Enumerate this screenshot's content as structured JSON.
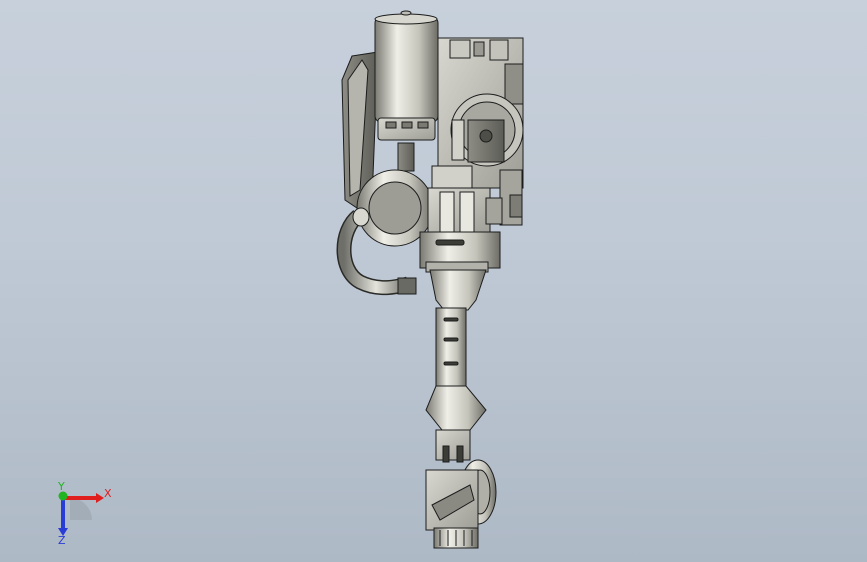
{
  "viewport": {
    "background_top": "#c7d0db",
    "background_bottom": "#aeb9c6"
  },
  "model": {
    "shading_light": "#e6e6df",
    "shading_mid": "#b9b9b0",
    "shading_dark": "#6e6e68",
    "edge_color": "#1c1c1c"
  },
  "triad": {
    "x_label": "X",
    "y_label": "Y",
    "z_label": "Z",
    "x_color": "#e01e1e",
    "y_color": "#22b422",
    "z_color": "#2a3cd6"
  }
}
